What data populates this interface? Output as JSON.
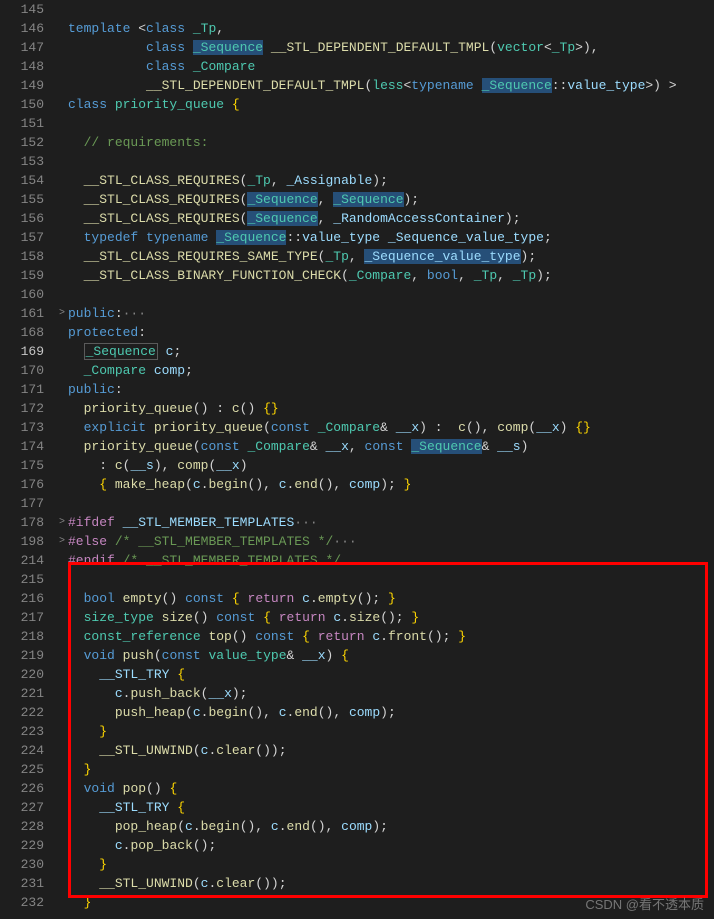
{
  "watermark": "CSDN @看不透本质",
  "gutter": [
    "145",
    "146",
    "147",
    "148",
    "149",
    "150",
    "151",
    "152",
    "153",
    "154",
    "155",
    "156",
    "157",
    "158",
    "159",
    "160",
    "161",
    "168",
    "169",
    "170",
    "171",
    "172",
    "173",
    "174",
    "175",
    "176",
    "177",
    "178",
    "198",
    "214",
    "215",
    "216",
    "217",
    "218",
    "219",
    "220",
    "221",
    "222",
    "223",
    "224",
    "225",
    "226",
    "227",
    "228",
    "229",
    "230",
    "231",
    "232"
  ],
  "activeLine": "169",
  "folds": {
    "161": ">",
    "178": ">",
    "198": ">"
  },
  "tokens": {
    "template": "template",
    "class": "class",
    "typedef": "typedef",
    "typename": "typename",
    "public": "public",
    "protected": "protected",
    "explicit": "explicit",
    "const": "const",
    "bool": "bool",
    "void": "void",
    "return": "return",
    "ifdef": "#ifdef",
    "else": "#else",
    "endif": "#endif",
    "_Tp": "_Tp",
    "_Sequence": "_Sequence",
    "_Compare": "_Compare",
    "vector": "vector",
    "less": "less",
    "pq": "priority_queue",
    "req": "__STL_CLASS_REQUIRES",
    "_Assignable": "_Assignable",
    "_Rac": "_RandomAccessContainer",
    "value_type": "value_type",
    "_Svt": "_Sequence_value_type",
    "same": "__STL_CLASS_REQUIRES_SAME_TYPE",
    "bfc": "__STL_CLASS_BINARY_FUNCTION_CHECK",
    "ddt": "__STL_DEPENDENT_DEFAULT_TMPL",
    "c": "c",
    "comp": "comp",
    "__x": "__x",
    "__s": "__s",
    "make_heap": "make_heap",
    "begin": "begin",
    "end": "end",
    "smt": "__STL_MEMBER_TEMPLATES",
    "com1": "// requirements:",
    "com2": "/* __STL_MEMBER_TEMPLATES */",
    "dots": "···",
    "empty": "empty",
    "size": "size",
    "size_type": "size_type",
    "top": "top",
    "const_ref": "const_reference",
    "front": "front",
    "push": "push",
    "push_back": "push_back",
    "push_heap": "push_heap",
    "try": "__STL_TRY",
    "unwind": "__STL_UNWIND",
    "clear": "clear",
    "pop": "pop",
    "pop_heap": "pop_heap",
    "pop_back": "pop_back"
  }
}
